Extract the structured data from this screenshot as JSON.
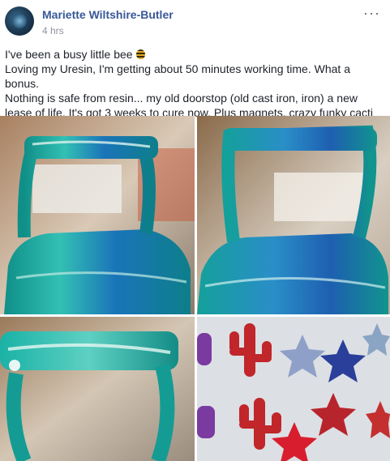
{
  "post": {
    "author": "Mariette Wiltshire-Butler",
    "time": "4 hrs",
    "more_icon": "···",
    "lines": [
      "I've been a busy little bee",
      "Loving my Uresin, I'm getting about 50 minutes working time. What a bonus.",
      "Nothing is safe from resin... my old doorstop (old cast iron, iron) a new lease of life. It's got 3 weeks to cure now. Plus magnets, crazy funky cacti etc"
    ]
  },
  "colors": {
    "author": "#385898",
    "resin_teal": "#1aa6a0",
    "resin_blue": "#1f5fb0"
  }
}
